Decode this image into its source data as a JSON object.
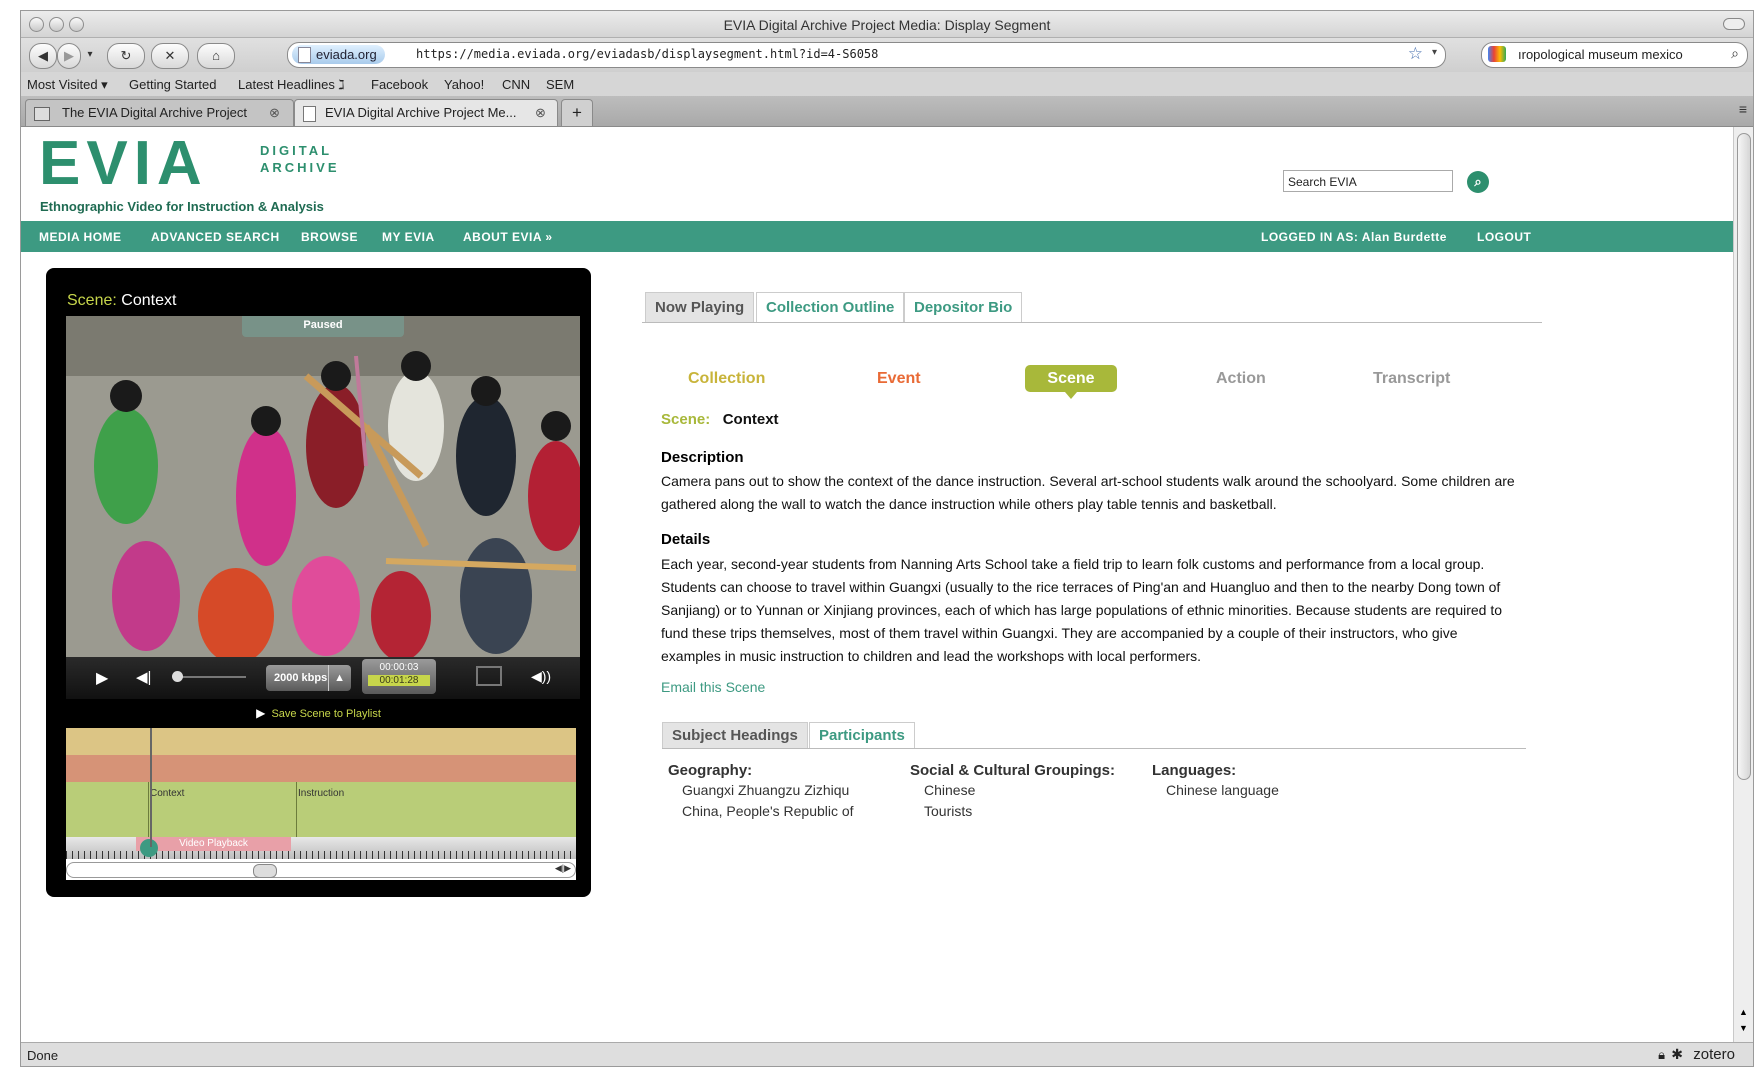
{
  "browser": {
    "window_title": "EVIA Digital Archive Project Media: Display Segment",
    "url_domain": "eviada.org",
    "url": "https://media.eviada.org/eviadasb/displaysegment.html?id=4-S6058",
    "search_text": "ıropological museum mexico",
    "bookmarks": [
      "Most Visited ▾",
      "Getting Started",
      "Latest Headlines ℷ",
      "Facebook",
      "Yahoo!",
      "CNN",
      "SEM"
    ],
    "tabs": [
      {
        "label": "The EVIA Digital Archive Project"
      },
      {
        "label": "EVIA Digital Archive Project Me..."
      }
    ],
    "new_tab": "+",
    "status": "Done",
    "zotero": "zotero"
  },
  "header": {
    "logo": "EVIA",
    "logo_line1": "DIGITAL",
    "logo_line2": "ARCHIVE",
    "tagline": "Ethnographic Video for Instruction & Analysis",
    "search_placeholder": "Search EVIA"
  },
  "nav": {
    "items": [
      "MEDIA HOME",
      "ADVANCED SEARCH",
      "BROWSE",
      "MY EVIA",
      "ABOUT EVIA »"
    ],
    "logged_in": "LOGGED IN AS: Alan Burdette",
    "logout": "LOGOUT"
  },
  "player": {
    "scene_prefix": "Scene:",
    "scene_name": "Context",
    "paused": "Paused",
    "bitrate": "2000 kbps",
    "time_current": "00:00:03",
    "time_total": "00:01:28",
    "progress": 0.03,
    "save_scene": "Save Scene to Playlist",
    "timeline_labels": [
      "Context",
      "Instruction"
    ],
    "playback_label": "Video Playback"
  },
  "content": {
    "tabs": [
      "Now Playing",
      "Collection Outline",
      "Depositor Bio"
    ],
    "crumbs": [
      "Collection",
      "Event",
      "Scene",
      "Action",
      "Transcript"
    ],
    "scene_label": "Scene:",
    "scene_value": "Context",
    "description_heading": "Description",
    "description": "Camera pans out to show the context of the dance instruction. Several art-school students walk around the schoolyard. Some children are gathered along the wall to watch the dance instruction while others play table tennis and basketball.",
    "details_heading": "Details",
    "details": "Each year, second-year students from Nanning Arts School take a field trip to learn folk customs and performance from a local group. Students can choose to travel within Guangxi (usually to the rice terraces of Ping'an and Huangluo and then to the nearby Dong town of Sanjiang) or to Yunnan or Xinjiang provinces, each of which has large populations of ethnic minorities. Because students are required to fund these trips themselves, most of them travel within Guangxi. They are accompanied by a couple of their instructors, who give examples in music instruction to children and lead the workshops with local performers.",
    "email_link": "Email this Scene",
    "sub_tabs": [
      "Subject Headings",
      "Participants"
    ],
    "geography": {
      "heading": "Geography:",
      "items": [
        "Guangxi Zhuangzu Zizhiqu",
        "China, People's Republic of"
      ]
    },
    "social": {
      "heading": "Social & Cultural Groupings:",
      "items": [
        "Chinese",
        "Tourists"
      ]
    },
    "languages": {
      "heading": "Languages:",
      "items": [
        "Chinese language"
      ]
    }
  }
}
